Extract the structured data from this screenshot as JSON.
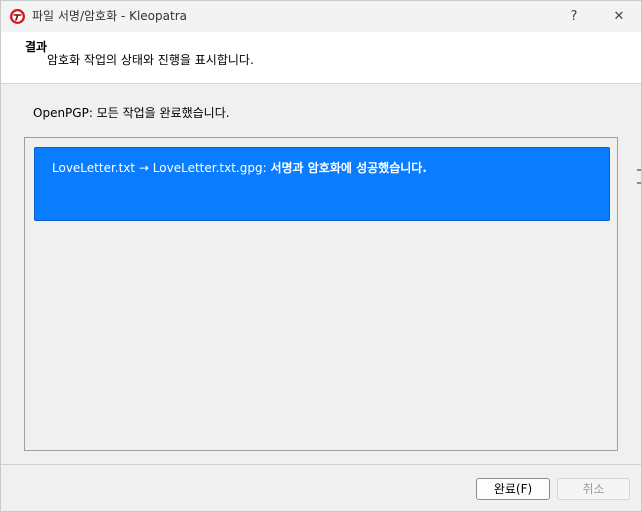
{
  "window": {
    "title": "파일 서명/암호화 - Kleopatra",
    "help_label": "?",
    "close_label": "✕",
    "app_icon": "kleopatra-icon"
  },
  "header": {
    "title": "결과",
    "subtitle": "암호화 작업의 상태와 진행을 표시합니다."
  },
  "status": {
    "text": "OpenPGP: 모든 작업을 완료했습니다."
  },
  "results": [
    {
      "prefix": "LoveLetter.txt → LoveLetter.txt.gpg: ",
      "message": "서명과 암호화에 성공했습니다.",
      "state_color": "#0a7cff"
    }
  ],
  "buttons": {
    "finish_label": "완료(F)",
    "cancel_label": "취소",
    "cancel_enabled": false
  }
}
